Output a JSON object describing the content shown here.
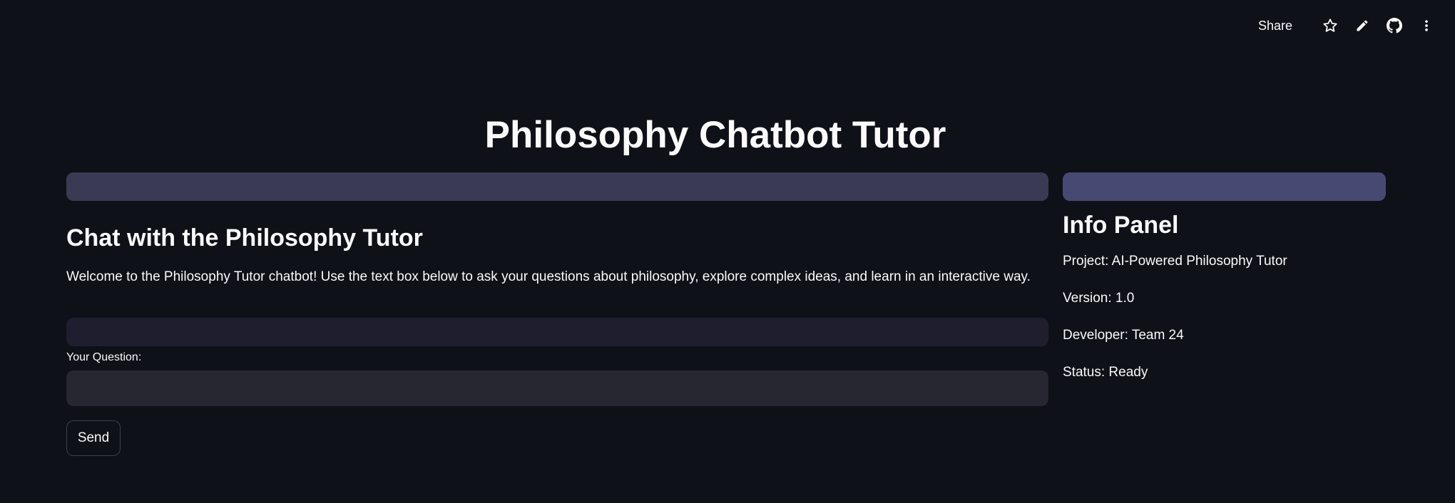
{
  "toolbar": {
    "share_label": "Share",
    "icons": [
      "star-icon",
      "pencil-icon",
      "github-icon",
      "more-vertical-icon"
    ]
  },
  "title": "Philosophy Chatbot Tutor",
  "chat": {
    "heading": "Chat with the Philosophy Tutor",
    "welcome": "Welcome to the Philosophy Tutor chatbot! Use the text box below to ask your questions about philosophy, explore complex ideas, and learn in an interactive way.",
    "question_label": "Your Question:",
    "question_value": "",
    "send_label": "Send"
  },
  "info": {
    "heading": "Info Panel",
    "project": "Project: AI-Powered Philosophy Tutor",
    "version": "Version: 1.0",
    "developer": "Developer: Team 24",
    "status": "Status: Ready"
  },
  "colors": {
    "background": "#0e1117",
    "text": "#fafafa",
    "left_banner": "#3b3a55",
    "right_banner": "#464a73",
    "history_box": "#1f1e2e",
    "input_bg": "#262730",
    "button_border": "#3d4049"
  }
}
